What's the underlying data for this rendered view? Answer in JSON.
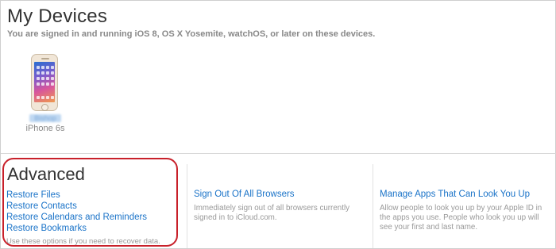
{
  "devices": {
    "title": "My Devices",
    "subtitle": "You are signed in and running iOS 8, OS X Yosemite, watchOS, or later on these devices.",
    "items": [
      {
        "owner_name": "Bishop",
        "model": "iPhone 6s",
        "icon": "iphone-icon"
      }
    ]
  },
  "advanced": {
    "title": "Advanced",
    "links": [
      {
        "label": "Restore Files"
      },
      {
        "label": "Restore Contacts"
      },
      {
        "label": "Restore Calendars and Reminders"
      },
      {
        "label": "Restore Bookmarks"
      }
    ],
    "note": "Use these options if you need to recover data."
  },
  "sign_out": {
    "link": "Sign Out Of All Browsers",
    "description": "Immediately sign out of all browsers currently signed in to iCloud.com."
  },
  "manage_apps": {
    "link": "Manage Apps That Can Look You Up",
    "description": "Allow people to look you up by your Apple ID in the apps you use. People who look you up will see your first and last name."
  },
  "colors": {
    "link": "#1a73c8",
    "highlight": "#c8202a",
    "muted": "#999999"
  }
}
